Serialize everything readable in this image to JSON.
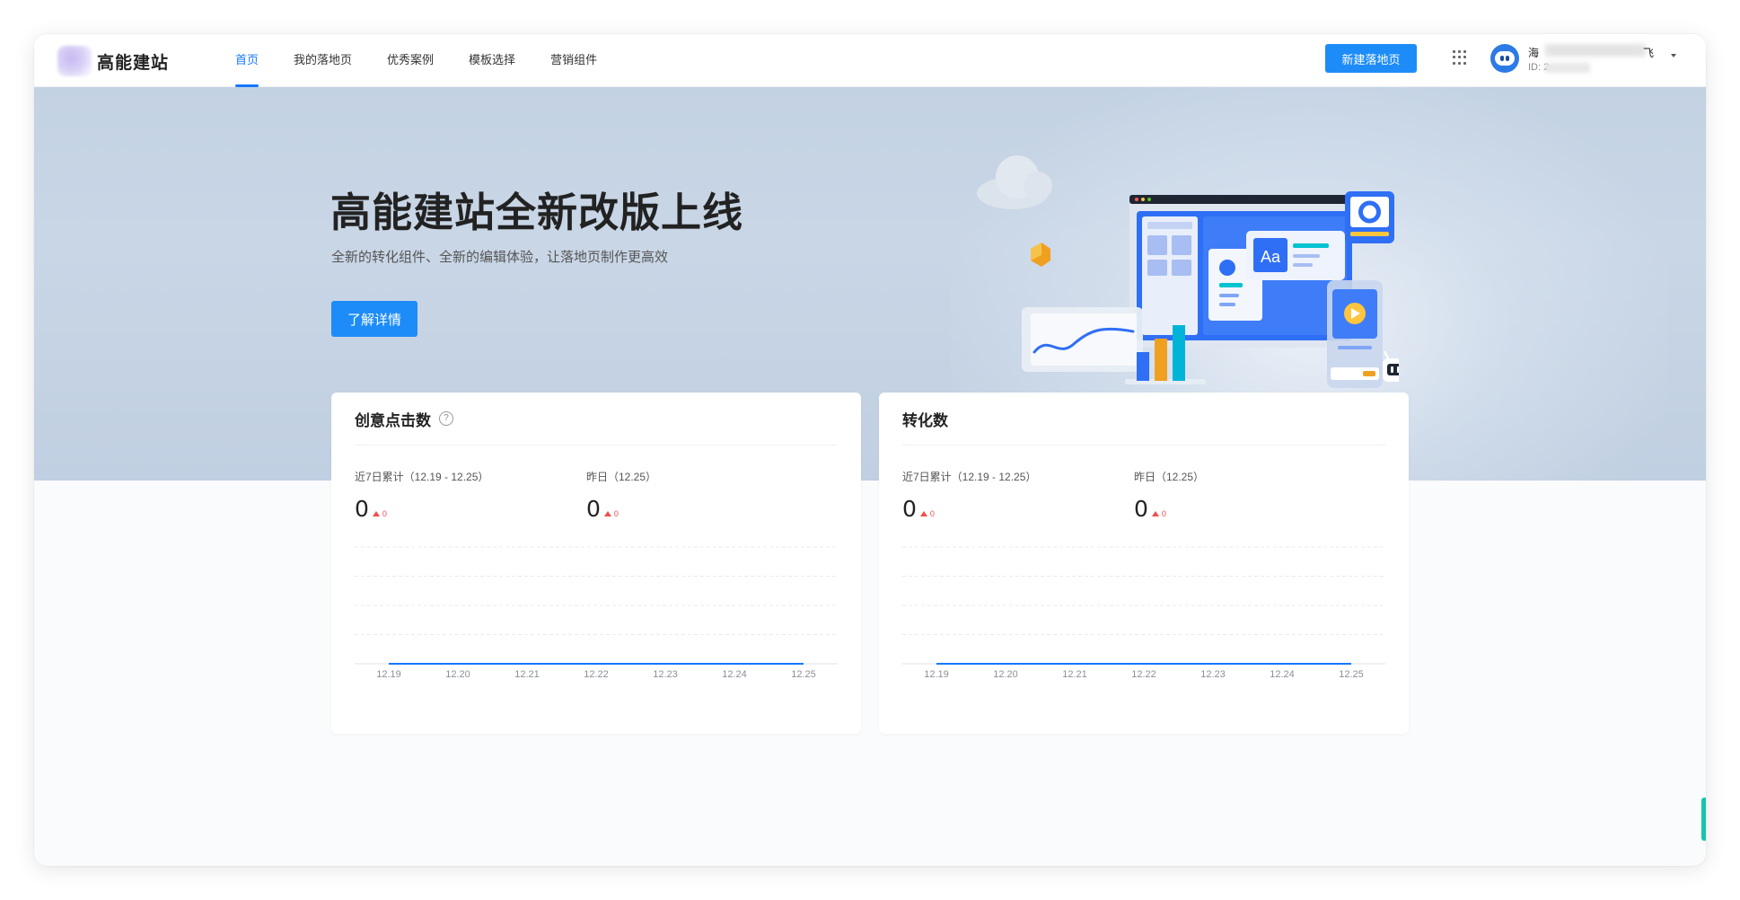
{
  "app": {
    "logo_text": "高能建站"
  },
  "nav": {
    "items": [
      "首页",
      "我的落地页",
      "优秀案例",
      "模板选择",
      "营销组件"
    ],
    "active_index": 0,
    "new_button": "新建落地页"
  },
  "user": {
    "name_start": "海",
    "name_end": "飞",
    "id_prefix": "ID: 2"
  },
  "hero": {
    "title": "高能建站全新改版上线",
    "subtitle": "全新的转化组件、全新的编辑体验，让落地页制作更高效",
    "button": "了解详情"
  },
  "cards": [
    {
      "title": "创意点击数",
      "has_help": true,
      "help_glyph": "?",
      "metric_week_label": "近7日累计（12.19 - 12.25）",
      "metric_week_value": "0",
      "metric_yest_label": "昨日（12.25）",
      "metric_yest_value": "0",
      "trend_text": "0"
    },
    {
      "title": "转化数",
      "has_help": false,
      "metric_week_label": "近7日累计（12.19 - 12.25）",
      "metric_week_value": "0",
      "metric_yest_label": "昨日（12.25）",
      "metric_yest_value": "0",
      "trend_text": "0"
    }
  ],
  "chart_data": [
    {
      "type": "line",
      "x": [
        "12.19",
        "12.20",
        "12.21",
        "12.22",
        "12.23",
        "12.24",
        "12.25"
      ],
      "series": [
        {
          "values": [
            0,
            0,
            0,
            0,
            0,
            0,
            0
          ]
        }
      ],
      "ylim": [
        0,
        5
      ],
      "grid": true,
      "color": "#1677ff"
    },
    {
      "type": "line",
      "x": [
        "12.19",
        "12.20",
        "12.21",
        "12.22",
        "12.23",
        "12.24",
        "12.25"
      ],
      "series": [
        {
          "values": [
            0,
            0,
            0,
            0,
            0,
            0,
            0
          ]
        }
      ],
      "ylim": [
        0,
        5
      ],
      "grid": true,
      "color": "#1677ff"
    }
  ],
  "colors": {
    "accent": "#1677ff",
    "button": "#1d8cf8",
    "trend_up": "#f24c4c"
  }
}
